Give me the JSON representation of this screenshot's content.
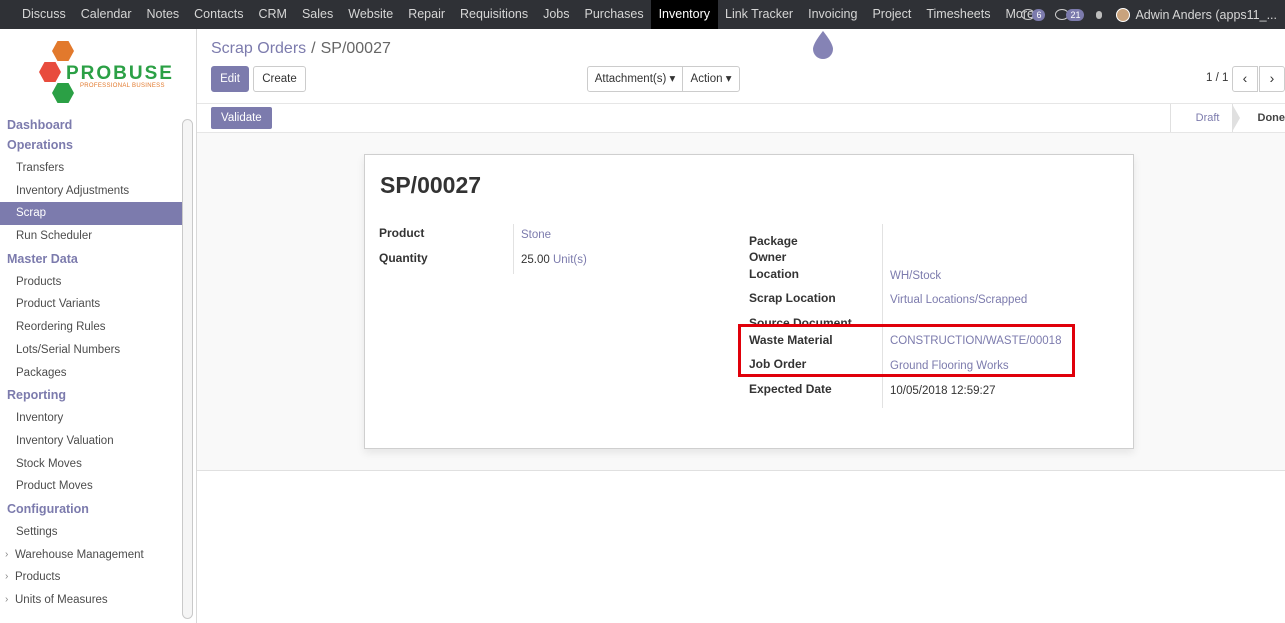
{
  "topbar": {
    "menu": [
      "Discuss",
      "Calendar",
      "Notes",
      "Contacts",
      "CRM",
      "Sales",
      "Website",
      "Repair",
      "Requisitions",
      "Jobs",
      "Purchases",
      "Inventory",
      "Link Tracker",
      "Invoicing",
      "Project",
      "Timesheets",
      "More"
    ],
    "active": "Inventory",
    "chat_count": "6",
    "activity_count": "21",
    "user": "Adwin Anders (apps11_..."
  },
  "logo": {
    "word": "PROBUSE",
    "tagline": "PROFESSIONAL BUSINESS"
  },
  "sidebar": {
    "sections": [
      {
        "title": "Dashboard",
        "items": []
      },
      {
        "title": "Operations",
        "items": [
          "Transfers",
          "Inventory Adjustments",
          "Scrap",
          "Run Scheduler"
        ]
      },
      {
        "title": "Master Data",
        "items": [
          "Products",
          "Product Variants",
          "Reordering Rules",
          "Lots/Serial Numbers",
          "Packages"
        ]
      },
      {
        "title": "Reporting",
        "items": [
          "Inventory",
          "Inventory Valuation",
          "Stock Moves",
          "Product Moves"
        ]
      },
      {
        "title": "Configuration",
        "items": [
          "Settings",
          "Warehouse Management",
          "Products",
          "Units of Measures"
        ]
      }
    ],
    "active_item": "Scrap"
  },
  "breadcrumb": {
    "parent": "Scrap Orders",
    "separator": "/",
    "current": "SP/00027"
  },
  "buttons": {
    "edit": "Edit",
    "create": "Create",
    "attachments": "Attachment(s) ▾",
    "action": "Action ▾",
    "validate": "Validate"
  },
  "pager": {
    "text": "1 / 1",
    "prev": "‹",
    "next": "›"
  },
  "stages": {
    "draft": "Draft",
    "done": "Done"
  },
  "form": {
    "title": "SP/00027",
    "product_label": "Product",
    "product_value": "Stone",
    "quantity_label": "Quantity",
    "quantity_value": "25.00",
    "quantity_uom": "Unit(s)",
    "package_label": "Package",
    "owner_label": "Owner",
    "location_label": "Location",
    "location_value": "WH/Stock",
    "scrap_location_label": "Scrap Location",
    "scrap_location_value": "Virtual Locations/Scrapped",
    "source_document_label": "Source Document",
    "waste_material_label": "Waste Material",
    "waste_material_value": "CONSTRUCTION/WASTE/00018",
    "job_order_label": "Job Order",
    "job_order_value": "Ground Flooring Works",
    "expected_date_label": "Expected Date",
    "expected_date_value": "10/05/2018 12:59:27"
  },
  "colors": {
    "accent": "#7c7bad",
    "topbar": "#2f3136",
    "highlight": "#e0000a"
  }
}
